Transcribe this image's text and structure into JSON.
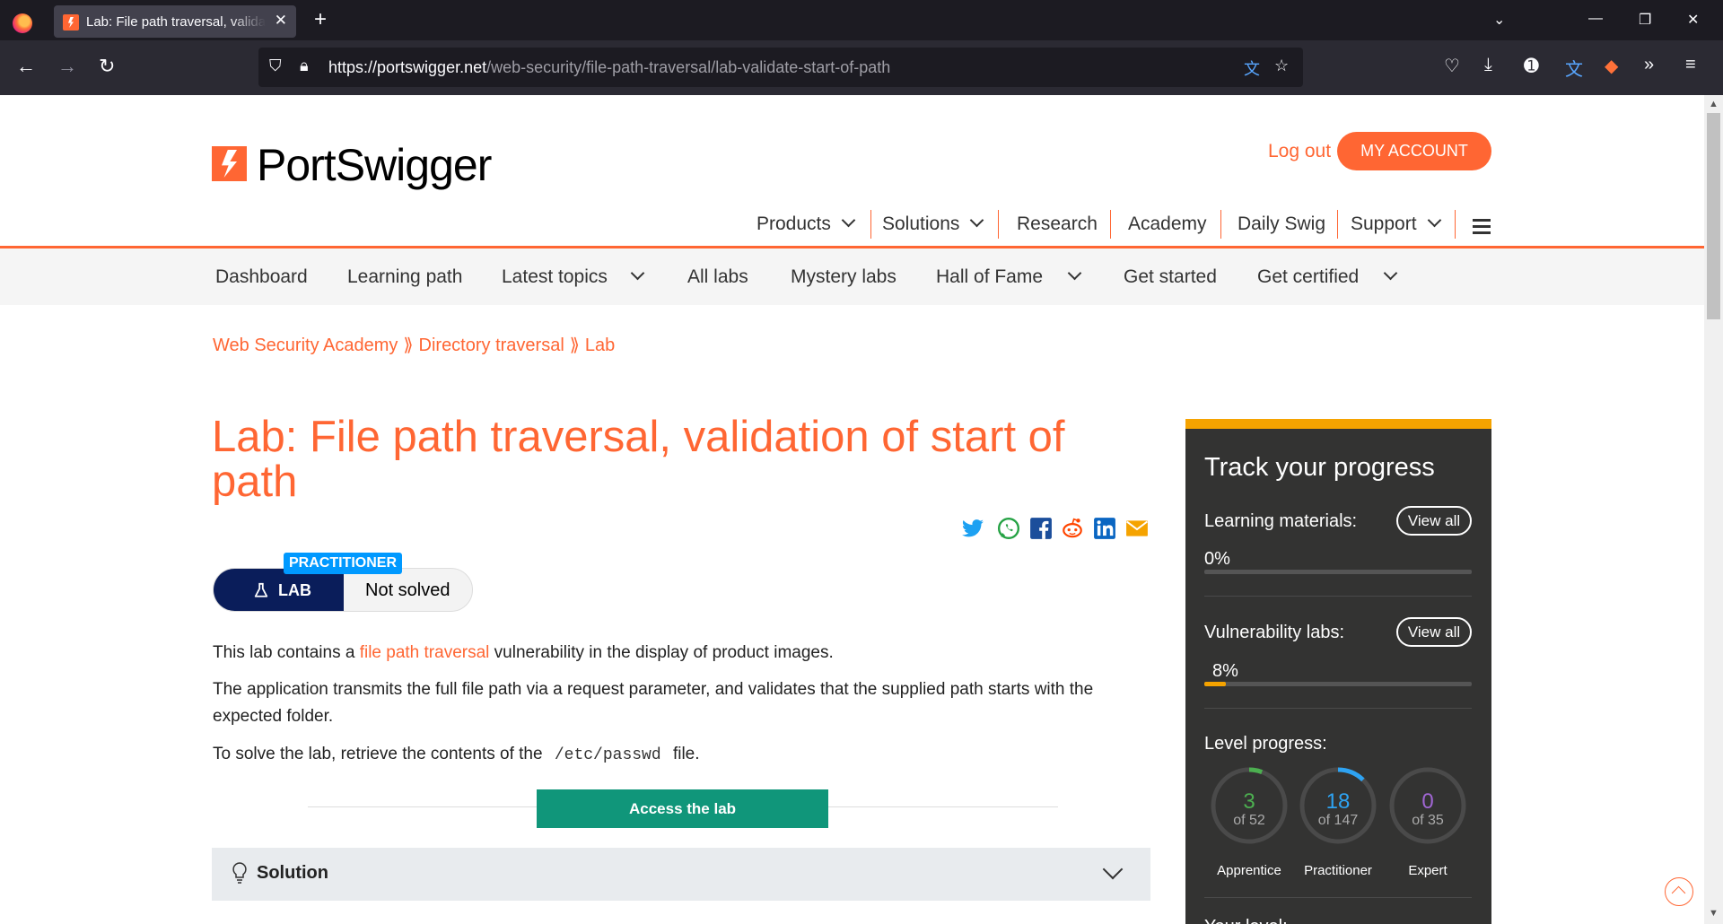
{
  "browser": {
    "tab_title": "Lab: File path traversal, validation of start of path",
    "url_host": "https://portswigger.net",
    "url_path": "/web-security/file-path-traversal/lab-validate-start-of-path"
  },
  "header": {
    "logo_text": "PortSwigger",
    "logout": "Log out",
    "my_account": "MY ACCOUNT",
    "nav": [
      "Products",
      "Solutions",
      "Research",
      "Academy",
      "Daily Swig",
      "Support"
    ]
  },
  "subnav": [
    "Dashboard",
    "Learning path",
    "Latest topics",
    "All labs",
    "Mystery labs",
    "Hall of Fame",
    "Get started",
    "Get certified"
  ],
  "breadcrumb": [
    "Web Security Academy",
    "Directory traversal",
    "Lab"
  ],
  "breadcrumb_sep": "⟫",
  "lab": {
    "title": "Lab: File path traversal, validation of start of path",
    "level": "PRACTITIONER",
    "type": "LAB",
    "status": "Not solved",
    "p1_before": "This lab contains a ",
    "p1_link": "file path traversal",
    "p1_after": " vulnerability in the display of product images.",
    "p2": "The application transmits the full file path via a request parameter, and validates that the supplied path starts with the expected folder.",
    "p3_before": "To solve the lab, retrieve the contents of the ",
    "p3_code": "/etc/passwd",
    "p3_after": " file.",
    "access_button": "Access the lab",
    "solution_label": "Solution"
  },
  "progress": {
    "title": "Track your progress",
    "learning_label": "Learning materials:",
    "learning_pct": "0%",
    "learning_value": 0,
    "vuln_label": "Vulnerability labs:",
    "vuln_pct": "8%",
    "vuln_value": 8,
    "view_all": "View all",
    "level_label": "Level progress:",
    "levels": [
      {
        "num": "3",
        "of": "of 52",
        "label": "Apprentice",
        "color": "#4caf50",
        "done": 3,
        "total": 52
      },
      {
        "num": "18",
        "of": "of 147",
        "label": "Practitioner",
        "color": "#2ea3f2",
        "done": 18,
        "total": 147
      },
      {
        "num": "0",
        "of": "of 35",
        "label": "Expert",
        "color": "#a066d3",
        "done": 0,
        "total": 35
      }
    ],
    "your_level": "Your level:"
  }
}
